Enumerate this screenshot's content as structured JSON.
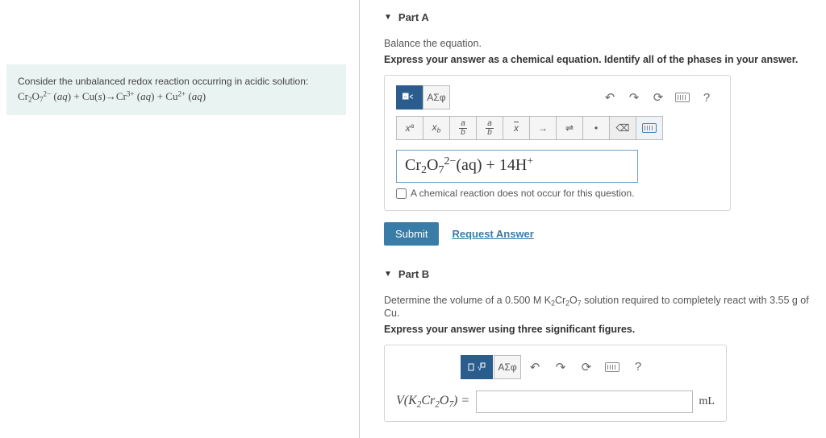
{
  "context": {
    "prompt": "Consider the unbalanced redox reaction occurring in acidic solution:",
    "equation_html": "Cr<sub>2</sub>O<sub>7</sub><sup>2−</sup> (aq) + Cu(s)→Cr<sup>3+</sup> (aq) + Cu<sup>2+</sup> (aq)"
  },
  "partA": {
    "title": "Part A",
    "instr1": "Balance the equation.",
    "instr2": "Express your answer as a chemical equation. Identify all of the phases in your answer.",
    "toolbar": {
      "greek": "ΑΣφ",
      "xa": "xᵃ",
      "xb": "x_b",
      "help": "?"
    },
    "input_html": "Cr<sub>2</sub>O<sub>7</sub><sup>2−</sup>(aq) + 14H<sup>+</sup>",
    "no_reaction_label": "A chemical reaction does not occur for this question.",
    "submit": "Submit",
    "request_answer": "Request Answer"
  },
  "partB": {
    "title": "Part B",
    "instr1_html": "Determine the volume of a 0.500 M K<sub>2</sub>Cr<sub>2</sub>O<sub>7</sub> solution required to completely react with 3.55 g of Cu.",
    "instr2": "Express your answer using three significant figures.",
    "toolbar": {
      "greek": "ΑΣφ",
      "help": "?"
    },
    "var_label_html": "V(K<sub>2</sub>Cr<sub>2</sub>O<sub>7</sub>) =",
    "value": "",
    "unit": "mL"
  }
}
